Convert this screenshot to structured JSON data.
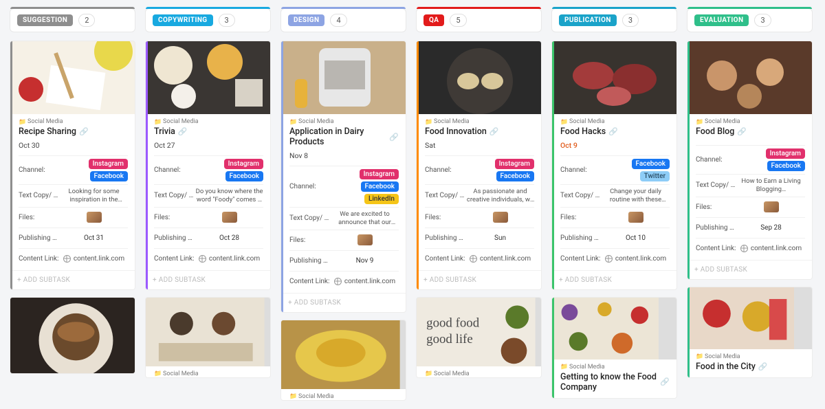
{
  "labels": {
    "category": "Social Media",
    "channel": "Channel:",
    "text_copy": "Text Copy/ C…",
    "files": "Files:",
    "publishing": "Publishing D…",
    "content_link": "Content Link:",
    "add_subtask": "+ ADD SUBTASK"
  },
  "columns": [
    {
      "id": "suggestion",
      "label": "SUGGESTION",
      "count": "2",
      "color": "#8e8e8e",
      "accent": "#8e8e8e",
      "cards": [
        {
          "title": "Recipe Sharing",
          "date": "Oct 30",
          "due": false,
          "channels": [
            "Instagram",
            "Facebook"
          ],
          "text": "Looking for some inspiration in the kitchen? Chec…",
          "pub": "Oct 31",
          "link": "content.link.com",
          "accent": "#8e8e8e",
          "full": true
        },
        {
          "image_only": true
        }
      ]
    },
    {
      "id": "copywriting",
      "label": "COPYWRITING",
      "count": "3",
      "color": "#18a9e0",
      "accent": "#9b59ff",
      "cards": [
        {
          "title": "Trivia",
          "date": "Oct 27",
          "due": false,
          "channels": [
            "Instagram",
            "Facebook"
          ],
          "text": "Do you know where the word \"Foody\" comes …",
          "pub": "Oct 28",
          "link": "content.link.com",
          "accent": "#9b59ff",
          "full": true
        },
        {
          "partial": true,
          "title": "good food good life",
          "title_is_image_text": true
        }
      ]
    },
    {
      "id": "design",
      "label": "DESIGN",
      "count": "4",
      "color": "#8da4e3",
      "accent": "#8da4e3",
      "cards": [
        {
          "title": "Application in Dairy Products",
          "date": "Nov 8",
          "due": false,
          "channels": [
            "Instagram",
            "Facebook",
            "LinkedIn"
          ],
          "text": "We are excited to announce that our product…",
          "pub": "Nov 9",
          "link": "content.link.com",
          "accent": "#8da4e3",
          "full": true
        },
        {
          "partial": true,
          "title": ""
        }
      ]
    },
    {
      "id": "qa",
      "label": "QA",
      "count": "5",
      "color": "#e21b1b",
      "accent": "#ff8a00",
      "cards": [
        {
          "title": "Food Innovation",
          "date": "Sat",
          "due": false,
          "channels": [
            "Instagram",
            "Facebook"
          ],
          "text": "As passionate and creative individuals, we want to l…",
          "pub": "Sun",
          "link": "content.link.com",
          "accent": "#ff8a00",
          "full": true
        },
        {
          "partial": true,
          "title": ""
        }
      ]
    },
    {
      "id": "publication",
      "label": "PUBLICATION",
      "count": "3",
      "color": "#1aa3c9",
      "accent": "#3bc46b",
      "cards": [
        {
          "title": "Food Hacks",
          "date": "Oct 9",
          "due": true,
          "channels": [
            "Facebook",
            "Twitter"
          ],
          "text": "Change your daily routine with these proven food …",
          "pub": "Oct 10",
          "link": "content.link.com",
          "accent": "#3bc46b",
          "full": true
        },
        {
          "title": "Getting to know the Food Company",
          "partial_body": true,
          "accent": "#3bc46b"
        }
      ]
    },
    {
      "id": "evaluation",
      "label": "EVALUATION",
      "count": "3",
      "color": "#2fbf8a",
      "accent": "#2fbf8a",
      "cards": [
        {
          "title": "Food Blog",
          "date": "",
          "due": false,
          "channels": [
            "Instagram",
            "Facebook"
          ],
          "text": "How to Earn a Living Blogging…",
          "pub": "Sep 28",
          "link": "content.link.com",
          "accent": "#2fbf8a",
          "full": true,
          "text_copy_label": "Text Copy/ C…"
        },
        {
          "title": "Food in the City",
          "partial_body": true,
          "accent": "#2fbf8a"
        }
      ]
    }
  ]
}
